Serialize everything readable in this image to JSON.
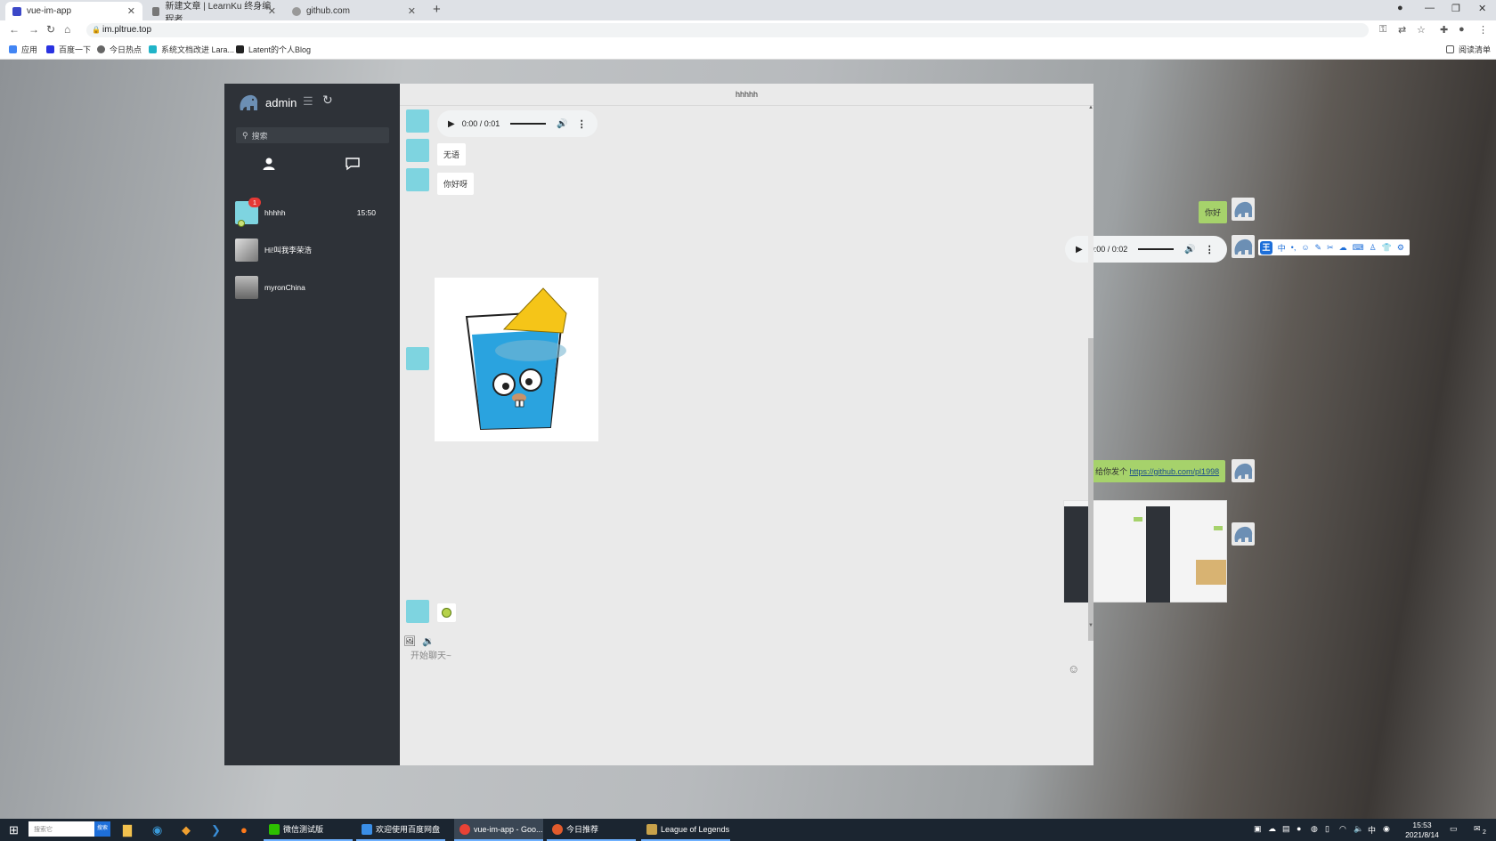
{
  "browser": {
    "tabs": [
      {
        "title": "vue-im-app",
        "active": true
      },
      {
        "title": "新建文章 | LearnKu 终身编程者...",
        "active": false
      },
      {
        "title": "github.com",
        "active": false
      }
    ],
    "url": "im.pltrue.top",
    "bookmarks": [
      "应用",
      "百度一下",
      "今日热点",
      "系统文档改进 Lara...",
      "Latent的个人Blog"
    ],
    "reading_list": "阅读清单"
  },
  "app": {
    "user": {
      "name": "admin"
    },
    "search": {
      "placeholder": "搜索"
    },
    "contacts": [
      {
        "name": "hhhhh",
        "time": "15:50",
        "badge": "1"
      },
      {
        "name": "Hi!叫我李荣浩",
        "time": "",
        "badge": ""
      },
      {
        "name": "myronChina",
        "time": "",
        "badge": ""
      }
    ],
    "chat": {
      "title": "hhhhh",
      "messages": {
        "audio1": {
          "time": "0:00 / 0:01"
        },
        "text1": "无语",
        "text2": "你好呀",
        "text3": "你好",
        "audio2": {
          "time": "0:00 / 0:02"
        },
        "link_prefix": "给你发个 ",
        "link_url": "https://github.com/pl1998"
      },
      "input_placeholder": "开始聊天~"
    }
  },
  "taskbar": {
    "search_placeholder": "搜索它",
    "search_button": "搜索",
    "apps": [
      {
        "title": "微信测试版"
      },
      {
        "title": "欢迎使用百度网盘"
      },
      {
        "title": "vue-im-app - Goo..."
      },
      {
        "title": "今日推荐"
      },
      {
        "title": "League of Legends"
      }
    ],
    "ime": "中",
    "clock": {
      "time": "15:53",
      "date": "2021/8/14"
    },
    "notifications": "2"
  },
  "colors": {
    "sidebar": "#2e3238",
    "chat_bg": "#eaeaea",
    "my_bubble": "#a6d26b",
    "accent": "#1e6fd9"
  }
}
